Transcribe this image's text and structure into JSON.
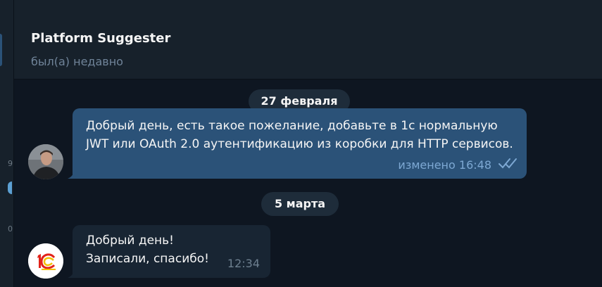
{
  "sidebar": {
    "counters": [
      "9",
      "0"
    ]
  },
  "header": {
    "title": "Platform Suggester",
    "status": "был(а) недавно"
  },
  "messages": [
    {
      "date": "27 февраля",
      "text": "Добрый день, есть такое пожелание, добавьте в 1с нормальную JWT или OAuth 2.0 аутентификацию из коробки для HTTP сервисов.",
      "meta": "изменено 16:48",
      "read_icon": "double-check-icon"
    },
    {
      "date": "5 марта",
      "text_line1": "Добрый день!",
      "text_line2": "Записали, спасибо!",
      "time": "12:34",
      "sender_icon": "1c-logo-icon"
    }
  ],
  "colors": {
    "background": "#0e1621",
    "header": "#17212b",
    "outgoing_bubble": "#2b5278",
    "incoming_bubble": "#182533",
    "accent": "#5ca0d3"
  }
}
